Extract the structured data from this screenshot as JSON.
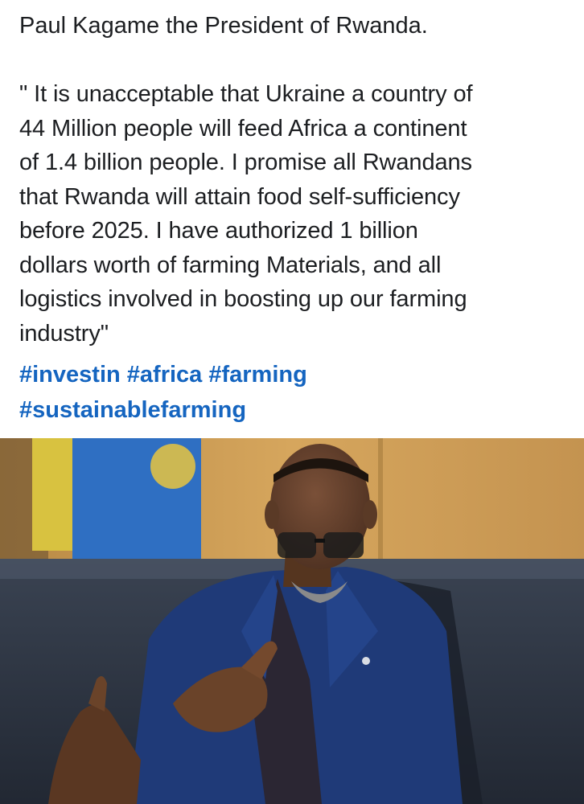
{
  "post": {
    "heading": "Paul Kagame the President of Rwanda.",
    "quote_lines": [
      "\" It is unacceptable that Ukraine a country of",
      "44 Million people will feed Africa a continent",
      "of 1.4 billion people. I promise all Rwandans",
      "that Rwanda will attain food self-sufficiency",
      "before 2025. I have authorized 1 billion",
      "dollars worth of farming Materials, and all",
      "logistics involved in boosting up our farming",
      "industry\""
    ],
    "hashtags": {
      "investin": "#investin",
      "africa": "#africa",
      "farming": "#farming",
      "sustainablefarming": "#sustainablefarming"
    }
  },
  "colors": {
    "hashtag": "#1565c0",
    "text": "#1c1e21",
    "suit": "#1f3a78",
    "background_wall": "#c9974f"
  },
  "photo": {
    "subject": "man-in-blue-suit-gesturing",
    "icon": "photo-icon"
  }
}
